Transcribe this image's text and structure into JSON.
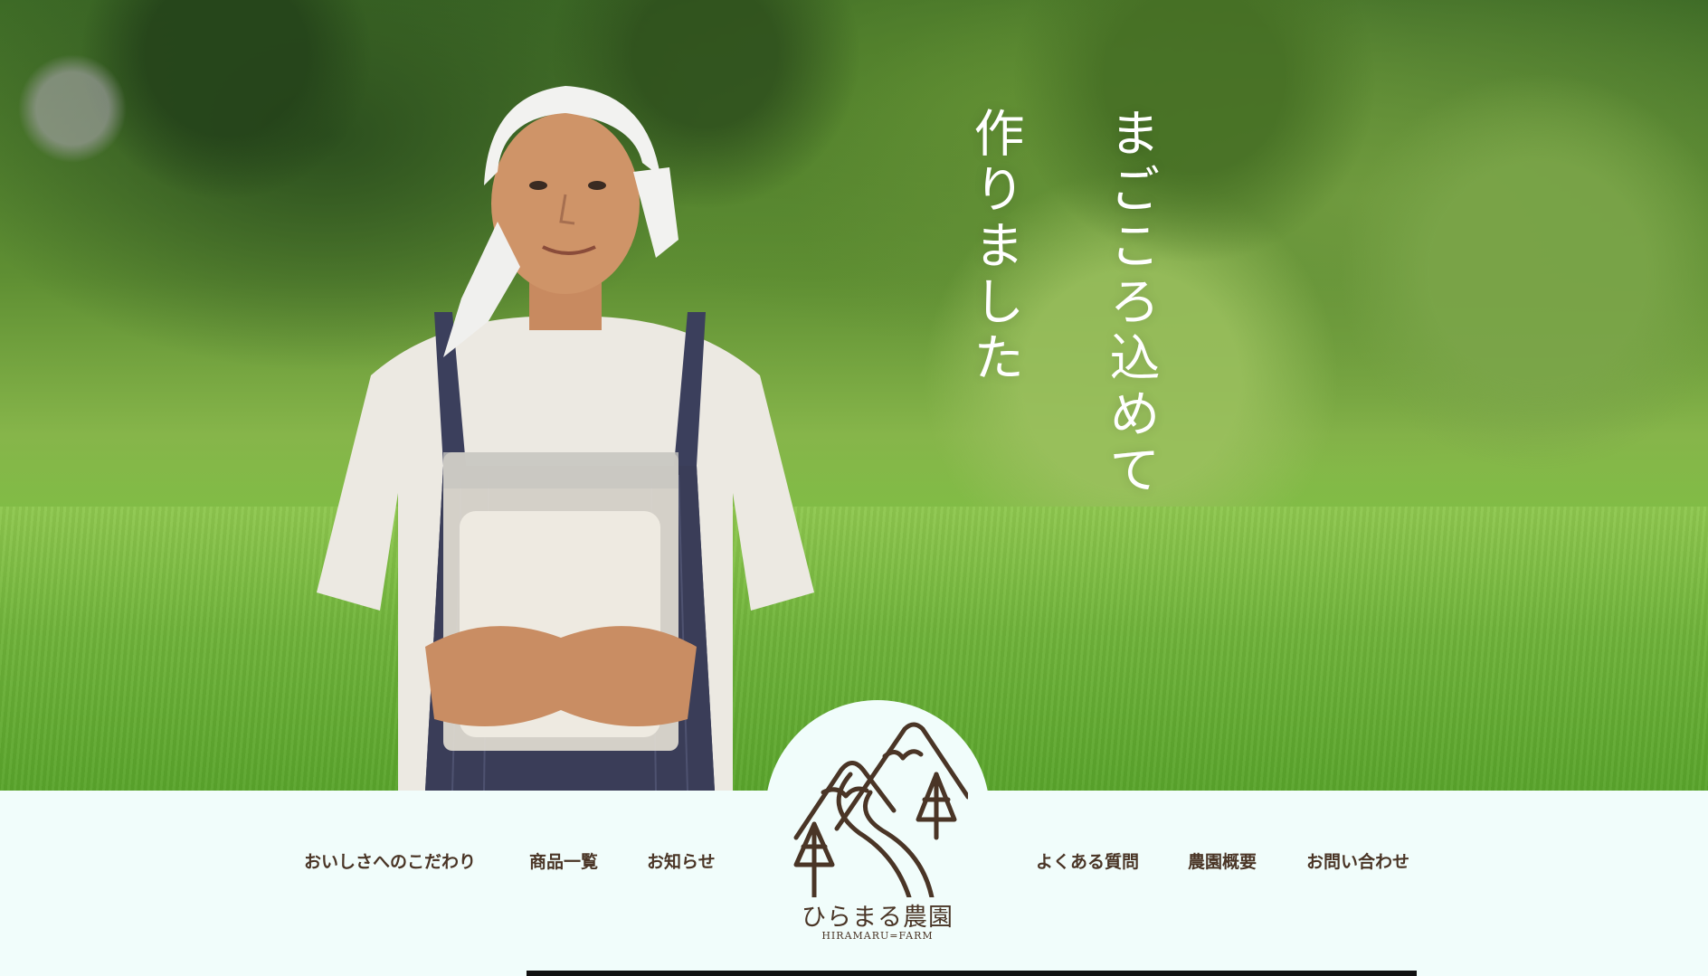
{
  "hero": {
    "catch_line_1": "まごころ込めて",
    "catch_line_2": "作りました"
  },
  "logo": {
    "name": "ひらまる農園",
    "sub": "HIRAMARU=FARM"
  },
  "nav": {
    "left": [
      "おいしさへのこだわり",
      "商品一覧",
      "お知らせ"
    ],
    "right": [
      "よくある質問",
      "農園概要",
      "お問い合わせ"
    ]
  },
  "colors": {
    "background": "#f1fdfb",
    "text_brown": "#4a3526",
    "hero_green": "#6fb33a"
  }
}
